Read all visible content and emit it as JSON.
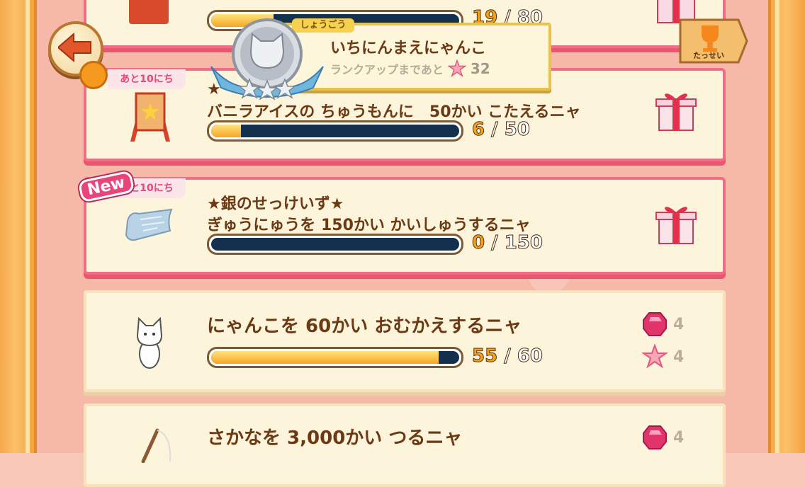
{
  "top_counter": {
    "current": "19",
    "max": "80"
  },
  "title_badge": {
    "tab_label": "しょうごう",
    "name": "いちにんまえにゃんこ",
    "rank_up_text": "ランクアップまであと",
    "rank_up_count": "32"
  },
  "achievements_label": "たっせい",
  "missions": [
    {
      "days_left": "あと10にち",
      "title": "★",
      "desc": "バニラアイスの ちゅうもんに　50かい こたえるニャ",
      "current": "6",
      "max": "50",
      "progress": 0.12
    },
    {
      "days_left": "あと10にち",
      "new_label": "New",
      "title": "★銀のせっけいず★",
      "desc": "ぎゅうにゅうを 150かい かいしゅうするニャ",
      "current": "0",
      "max": "150",
      "progress": 0
    },
    {
      "desc": "にゃんこを 60かい おむかえするニャ",
      "current": "55",
      "max": "60",
      "progress": 0.917,
      "reward_gem": "4",
      "reward_star": "4"
    },
    {
      "desc": "さかなを 3,000かい つるニャ",
      "reward_gem": "4"
    }
  ],
  "colors": {
    "accent_pink": "#ef6d86",
    "bar_fill": "#f6a626",
    "bar_track": "#13314d",
    "text_brown": "#6b3a14"
  }
}
